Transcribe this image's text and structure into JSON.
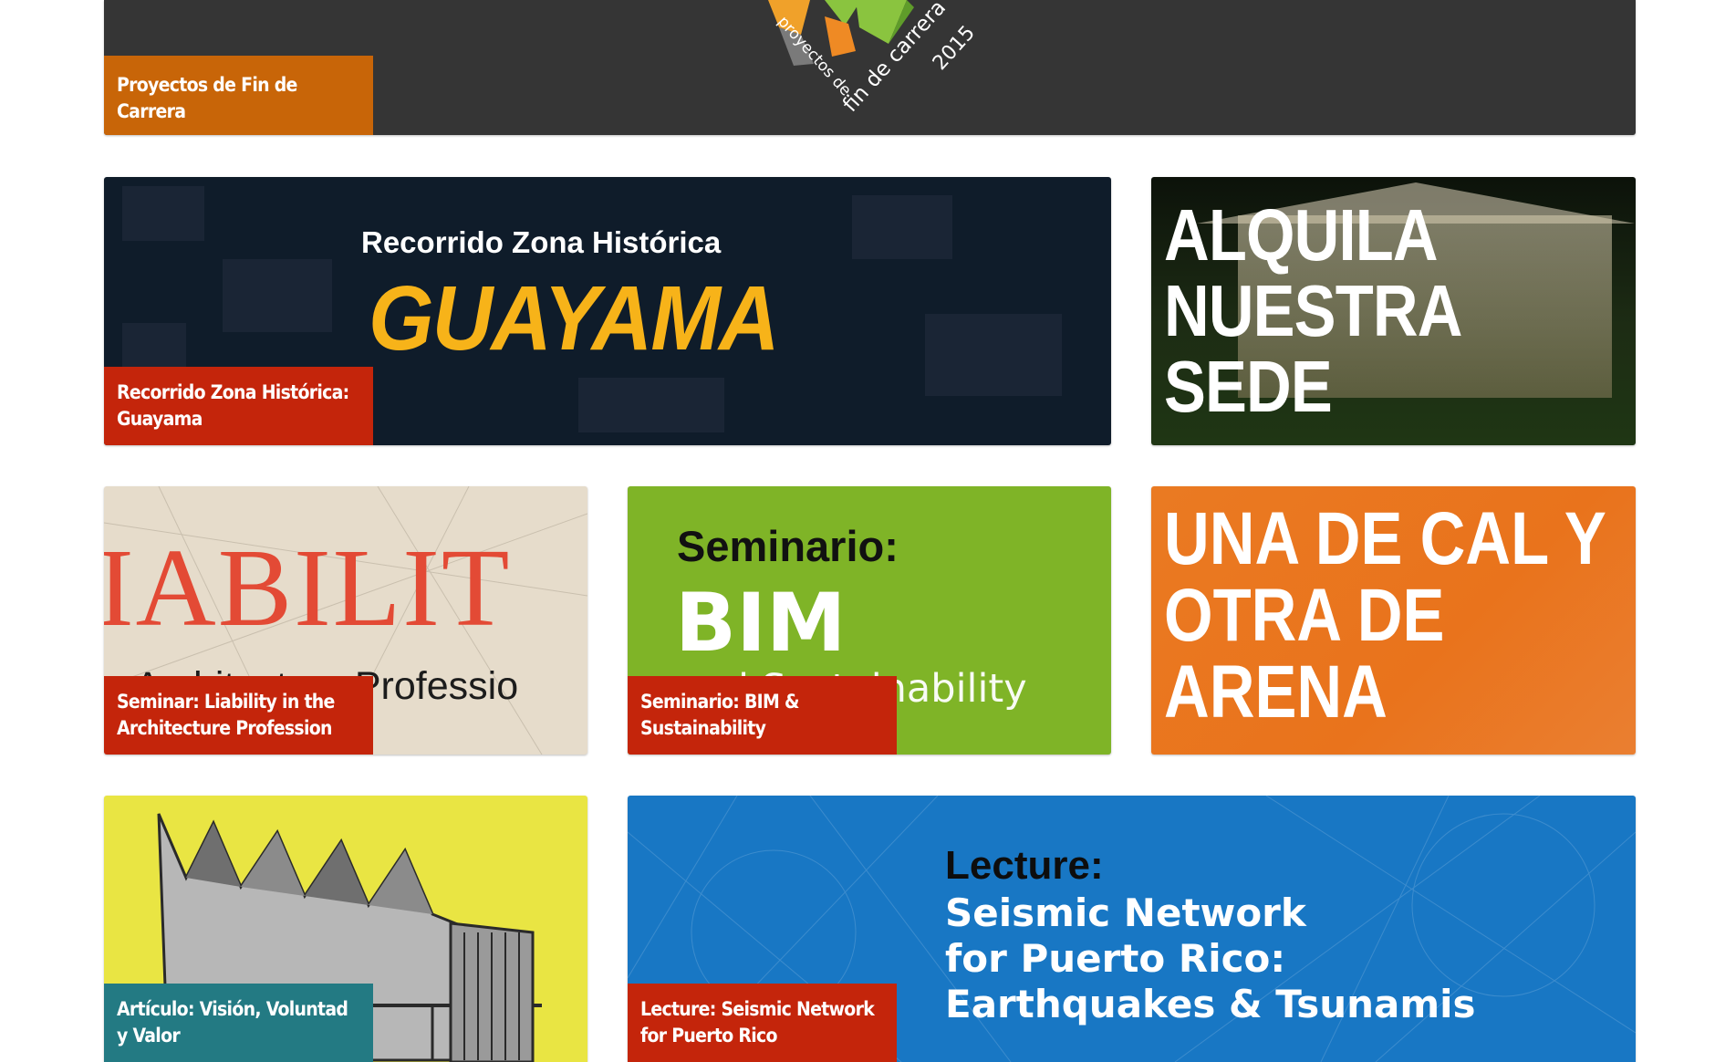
{
  "tiles": {
    "header": {
      "caption": "Proyectos de Fin de Carrera",
      "logo_text_1": "proyectos de",
      "logo_text_2": "fin de carrera",
      "logo_text_3": "2015"
    },
    "guayama": {
      "subtitle": "Recorrido Zona Histórica",
      "title": "GUAYAMA",
      "caption": "Recorrido Zona Histórica: Guayama"
    },
    "alquila": {
      "lines": [
        "ALQUILA",
        "NUESTRA",
        "SEDE"
      ]
    },
    "liability": {
      "big_text": "IABILIT",
      "sub_text": "e Architecture Professio",
      "caption": "Seminar: Liability in the Architecture Profession"
    },
    "bim": {
      "line1": "Seminario:",
      "line2": "BIM",
      "line3": "and Sustainability",
      "caption": "Seminario: BIM & Sustainability"
    },
    "cal": {
      "lines": [
        "UNA DE CAL Y",
        "OTRA DE",
        "ARENA"
      ]
    },
    "articulo": {
      "caption": "Artículo: Visión, Voluntad y Valor"
    },
    "lecture": {
      "line1": "Lecture:",
      "line2": "Seismic Network",
      "line3": "for Puerto Rico:",
      "line4": "Earthquakes & Tsunamis",
      "caption": "Lecture: Seismic Network for Puerto Rico"
    }
  },
  "colors": {
    "caption_red": "#c4250b",
    "caption_orange": "#c86508",
    "caption_teal": "#237a83",
    "header_bg": "#353535",
    "guayama_accent": "#f7b319",
    "bim_green": "#7fb427",
    "cal_orange": "#e9731c",
    "lecture_blue": "#1877c4",
    "articulo_yellow": "#e9e543"
  }
}
